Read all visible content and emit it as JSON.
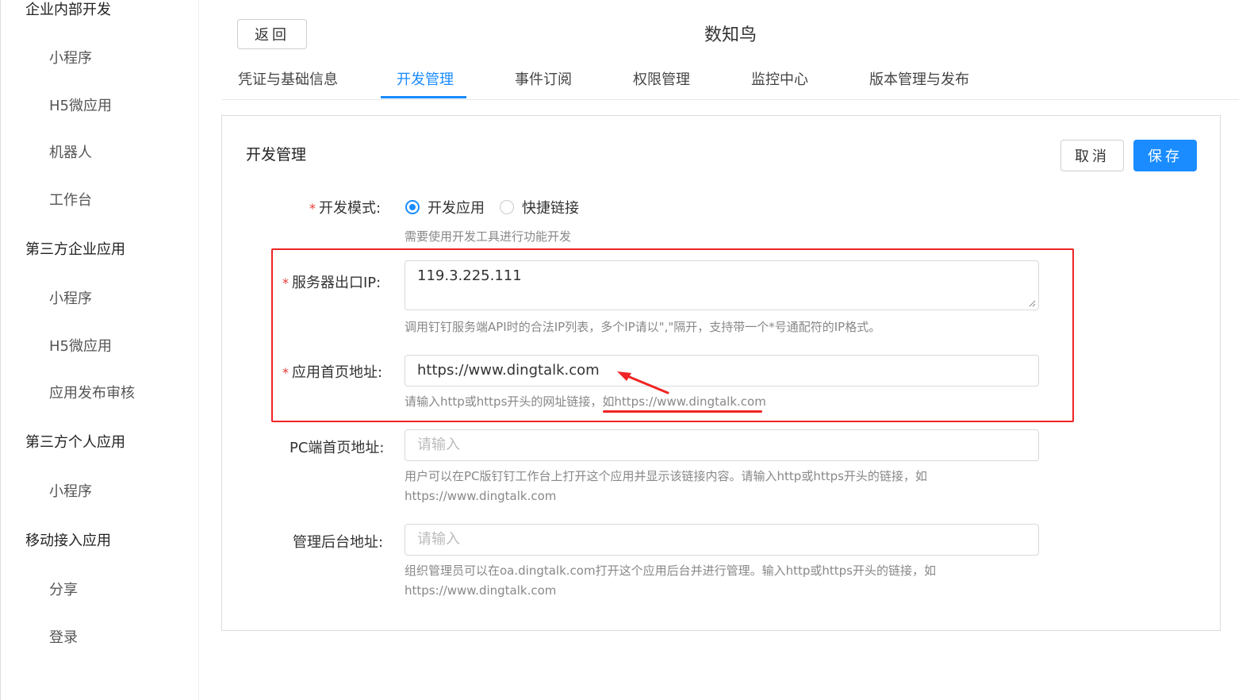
{
  "sidebar": {
    "groups": [
      {
        "label": "企业内部开发",
        "items": [
          "小程序",
          "H5微应用",
          "机器人",
          "工作台"
        ]
      },
      {
        "label": "第三方企业应用",
        "items": [
          "小程序",
          "H5微应用",
          "应用发布审核"
        ]
      },
      {
        "label": "第三方个人应用",
        "items": [
          "小程序"
        ]
      },
      {
        "label": "移动接入应用",
        "items": [
          "分享",
          "登录"
        ]
      }
    ]
  },
  "header": {
    "back_label": "返回",
    "app_title": "数知鸟"
  },
  "tabs": [
    {
      "label": "凭证与基础信息",
      "active": false
    },
    {
      "label": "开发管理",
      "active": true
    },
    {
      "label": "事件订阅",
      "active": false
    },
    {
      "label": "权限管理",
      "active": false
    },
    {
      "label": "监控中心",
      "active": false
    },
    {
      "label": "版本管理与发布",
      "active": false
    }
  ],
  "panel": {
    "title": "开发管理",
    "cancel_label": "取消",
    "save_label": "保存",
    "dev_mode": {
      "label": "开发模式:",
      "options": [
        "开发应用",
        "快捷链接"
      ],
      "selected": "开发应用",
      "hint": "需要使用开发工具进行功能开发"
    },
    "server_ip": {
      "label": "服务器出口IP:",
      "value": "119.3.225.111",
      "hint": "调用钉钉服务端API时的合法IP列表，多个IP请以\",\"隔开，支持带一个*号通配符的IP格式。"
    },
    "homepage": {
      "label": "应用首页地址:",
      "value": "https://www.dingtalk.com",
      "hint_prefix": "请输入http或https开头的网址链接，",
      "hint_example": "如https://www.dingtalk.com"
    },
    "pc_homepage": {
      "label": "PC端首页地址:",
      "placeholder": "请输入",
      "hint_line1": "用户可以在PC版钉钉工作台上打开这个应用并显示该链接内容。请输入http或https开头的链接，如",
      "hint_line2": "https://www.dingtalk.com"
    },
    "admin_url": {
      "label": "管理后台地址:",
      "placeholder": "请输入",
      "hint_line1": "组织管理员可以在oa.dingtalk.com打开这个应用后台并进行管理。输入http或https开头的链接，如",
      "hint_line2": "https://www.dingtalk.com"
    }
  },
  "colors": {
    "accent": "#1a8cff",
    "required": "#e53935",
    "annotation": "#f02424"
  }
}
